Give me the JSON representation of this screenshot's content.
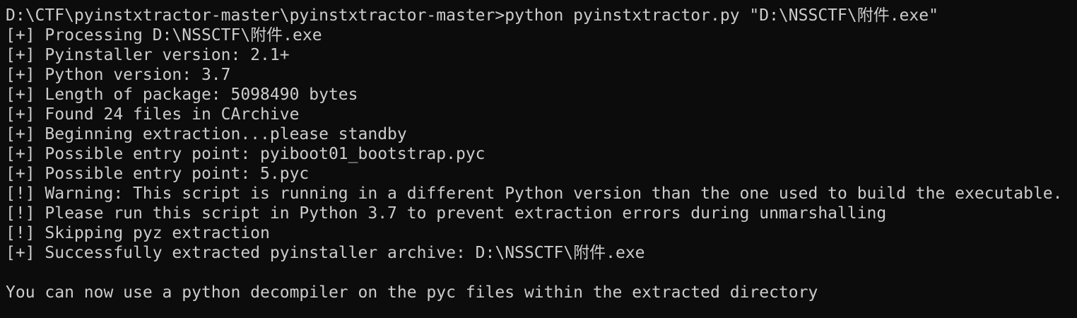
{
  "terminal": {
    "background_color": "#0c0c0c",
    "text_color": "#cccccc",
    "lines": [
      "D:\\CTF\\pyinstxtractor-master\\pyinstxtractor-master>python pyinstxtractor.py \"D:\\NSSCTF\\附件.exe\"",
      "[+] Processing D:\\NSSCTF\\附件.exe",
      "[+] Pyinstaller version: 2.1+",
      "[+] Python version: 3.7",
      "[+] Length of package: 5098490 bytes",
      "[+] Found 24 files in CArchive",
      "[+] Beginning extraction...please standby",
      "[+] Possible entry point: pyiboot01_bootstrap.pyc",
      "[+] Possible entry point: 5.pyc",
      "[!] Warning: This script is running in a different Python version than the one used to build the executable.",
      "[!] Please run this script in Python 3.7 to prevent extraction errors during unmarshalling",
      "[!] Skipping pyz extraction",
      "[+] Successfully extracted pyinstaller archive: D:\\NSSCTF\\附件.exe",
      "",
      "You can now use a python decompiler on the pyc files within the extracted directory"
    ]
  }
}
